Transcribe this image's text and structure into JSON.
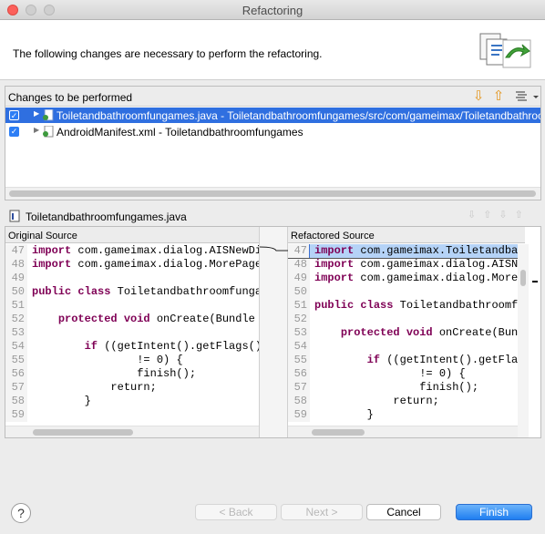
{
  "window": {
    "title": "Refactoring"
  },
  "header": {
    "message": "The following changes are necessary to perform the refactoring."
  },
  "changes": {
    "label": "Changes to be performed",
    "items": [
      {
        "text": "Toiletandbathroomfungames.java - Toiletandbathroomfungames/src/com/gameimax/Toiletandbathroomfu",
        "checked": true,
        "selected": true
      },
      {
        "text": "AndroidManifest.xml - Toiletandbathroomfungames",
        "checked": true,
        "selected": false
      }
    ]
  },
  "file": {
    "name": "Toiletandbathroomfungames.java"
  },
  "compare": {
    "original_label": "Original Source",
    "refactored_label": "Refactored Source",
    "original_lines": [
      {
        "n": "47",
        "t": "import com.gameimax.dialog.AISNewDia"
      },
      {
        "n": "48",
        "t": "import com.gameimax.dialog.MorePage"
      },
      {
        "n": "49",
        "t": ""
      },
      {
        "n": "50",
        "t": "public class Toiletandbathroomfungam"
      },
      {
        "n": "51",
        "t": ""
      },
      {
        "n": "52",
        "t": "    protected void onCreate(Bundle s"
      },
      {
        "n": "53",
        "t": ""
      },
      {
        "n": "54",
        "t": "        if ((getIntent().getFlags()"
      },
      {
        "n": "55",
        "t": "                != 0) {"
      },
      {
        "n": "56",
        "t": "                finish();"
      },
      {
        "n": "57",
        "t": "            return;"
      },
      {
        "n": "58",
        "t": "        }"
      },
      {
        "n": "59",
        "t": ""
      }
    ],
    "refactored_lines": [
      {
        "n": "47",
        "t": "import com.gameimax.Toiletandbat"
      },
      {
        "n": "48",
        "t": "import com.gameimax.dialog.AISNe"
      },
      {
        "n": "49",
        "t": "import com.gameimax.dialog.MoreP"
      },
      {
        "n": "50",
        "t": ""
      },
      {
        "n": "51",
        "t": "public class Toiletandbathroomfu"
      },
      {
        "n": "52",
        "t": ""
      },
      {
        "n": "53",
        "t": "    protected void onCreate(Bund"
      },
      {
        "n": "54",
        "t": ""
      },
      {
        "n": "55",
        "t": "        if ((getIntent().getFlag"
      },
      {
        "n": "56",
        "t": "                != 0) {"
      },
      {
        "n": "57",
        "t": "                finish();"
      },
      {
        "n": "58",
        "t": "            return;"
      },
      {
        "n": "59",
        "t": "        }"
      }
    ]
  },
  "buttons": {
    "back": "< Back",
    "next": "Next >",
    "cancel": "Cancel",
    "finish": "Finish",
    "help": "?"
  },
  "colors": {
    "accent": "#3b8cf5",
    "selection": "#2f6fe0",
    "keyword": "#7f0055"
  }
}
